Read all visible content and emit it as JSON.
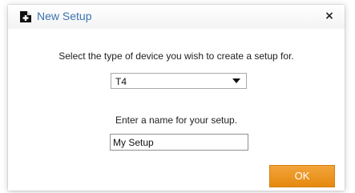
{
  "window": {
    "title": "New Setup",
    "close_symbol": "×",
    "icon": "new-document-icon"
  },
  "device": {
    "prompt": "Select the type of device you wish to create a setup for.",
    "selected": "T4"
  },
  "name": {
    "prompt": "Enter a name for your setup.",
    "value": "My Setup"
  },
  "actions": {
    "ok_label": "OK"
  },
  "colors": {
    "title_text": "#3a74b0",
    "ok_button": "#ee9a2a"
  }
}
